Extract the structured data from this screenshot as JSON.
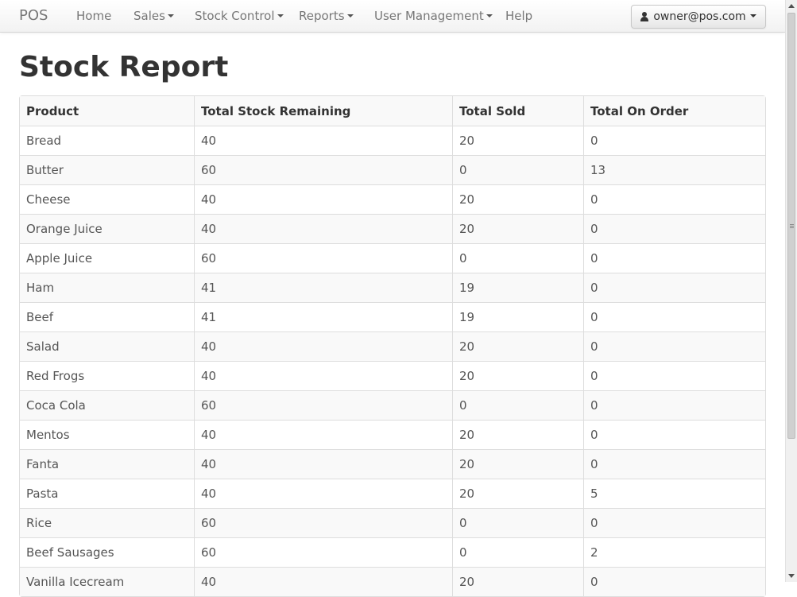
{
  "navbar": {
    "brand": "POS",
    "items": [
      {
        "label": "Home",
        "dropdown": false
      },
      {
        "label": "Sales",
        "dropdown": true
      },
      {
        "label": "Stock Control",
        "dropdown": true
      },
      {
        "label": "Reports",
        "dropdown": true
      },
      {
        "label": "User Management",
        "dropdown": true
      },
      {
        "label": "Help",
        "dropdown": false
      }
    ],
    "user_label": "owner@pos.com"
  },
  "page": {
    "title": "Stock Report"
  },
  "table": {
    "headers": [
      "Product",
      "Total Stock Remaining",
      "Total Sold",
      "Total On Order"
    ],
    "rows": [
      [
        "Bread",
        "40",
        "20",
        "0"
      ],
      [
        "Butter",
        "60",
        "0",
        "13"
      ],
      [
        "Cheese",
        "40",
        "20",
        "0"
      ],
      [
        "Orange Juice",
        "40",
        "20",
        "0"
      ],
      [
        "Apple Juice",
        "60",
        "0",
        "0"
      ],
      [
        "Ham",
        "41",
        "19",
        "0"
      ],
      [
        "Beef",
        "41",
        "19",
        "0"
      ],
      [
        "Salad",
        "40",
        "20",
        "0"
      ],
      [
        "Red Frogs",
        "40",
        "20",
        "0"
      ],
      [
        "Coca Cola",
        "60",
        "0",
        "0"
      ],
      [
        "Mentos",
        "40",
        "20",
        "0"
      ],
      [
        "Fanta",
        "40",
        "20",
        "0"
      ],
      [
        "Pasta",
        "40",
        "20",
        "5"
      ],
      [
        "Rice",
        "60",
        "0",
        "0"
      ],
      [
        "Beef Sausages",
        "60",
        "0",
        "2"
      ],
      [
        "Vanilla Icecream",
        "40",
        "20",
        "0"
      ]
    ]
  }
}
